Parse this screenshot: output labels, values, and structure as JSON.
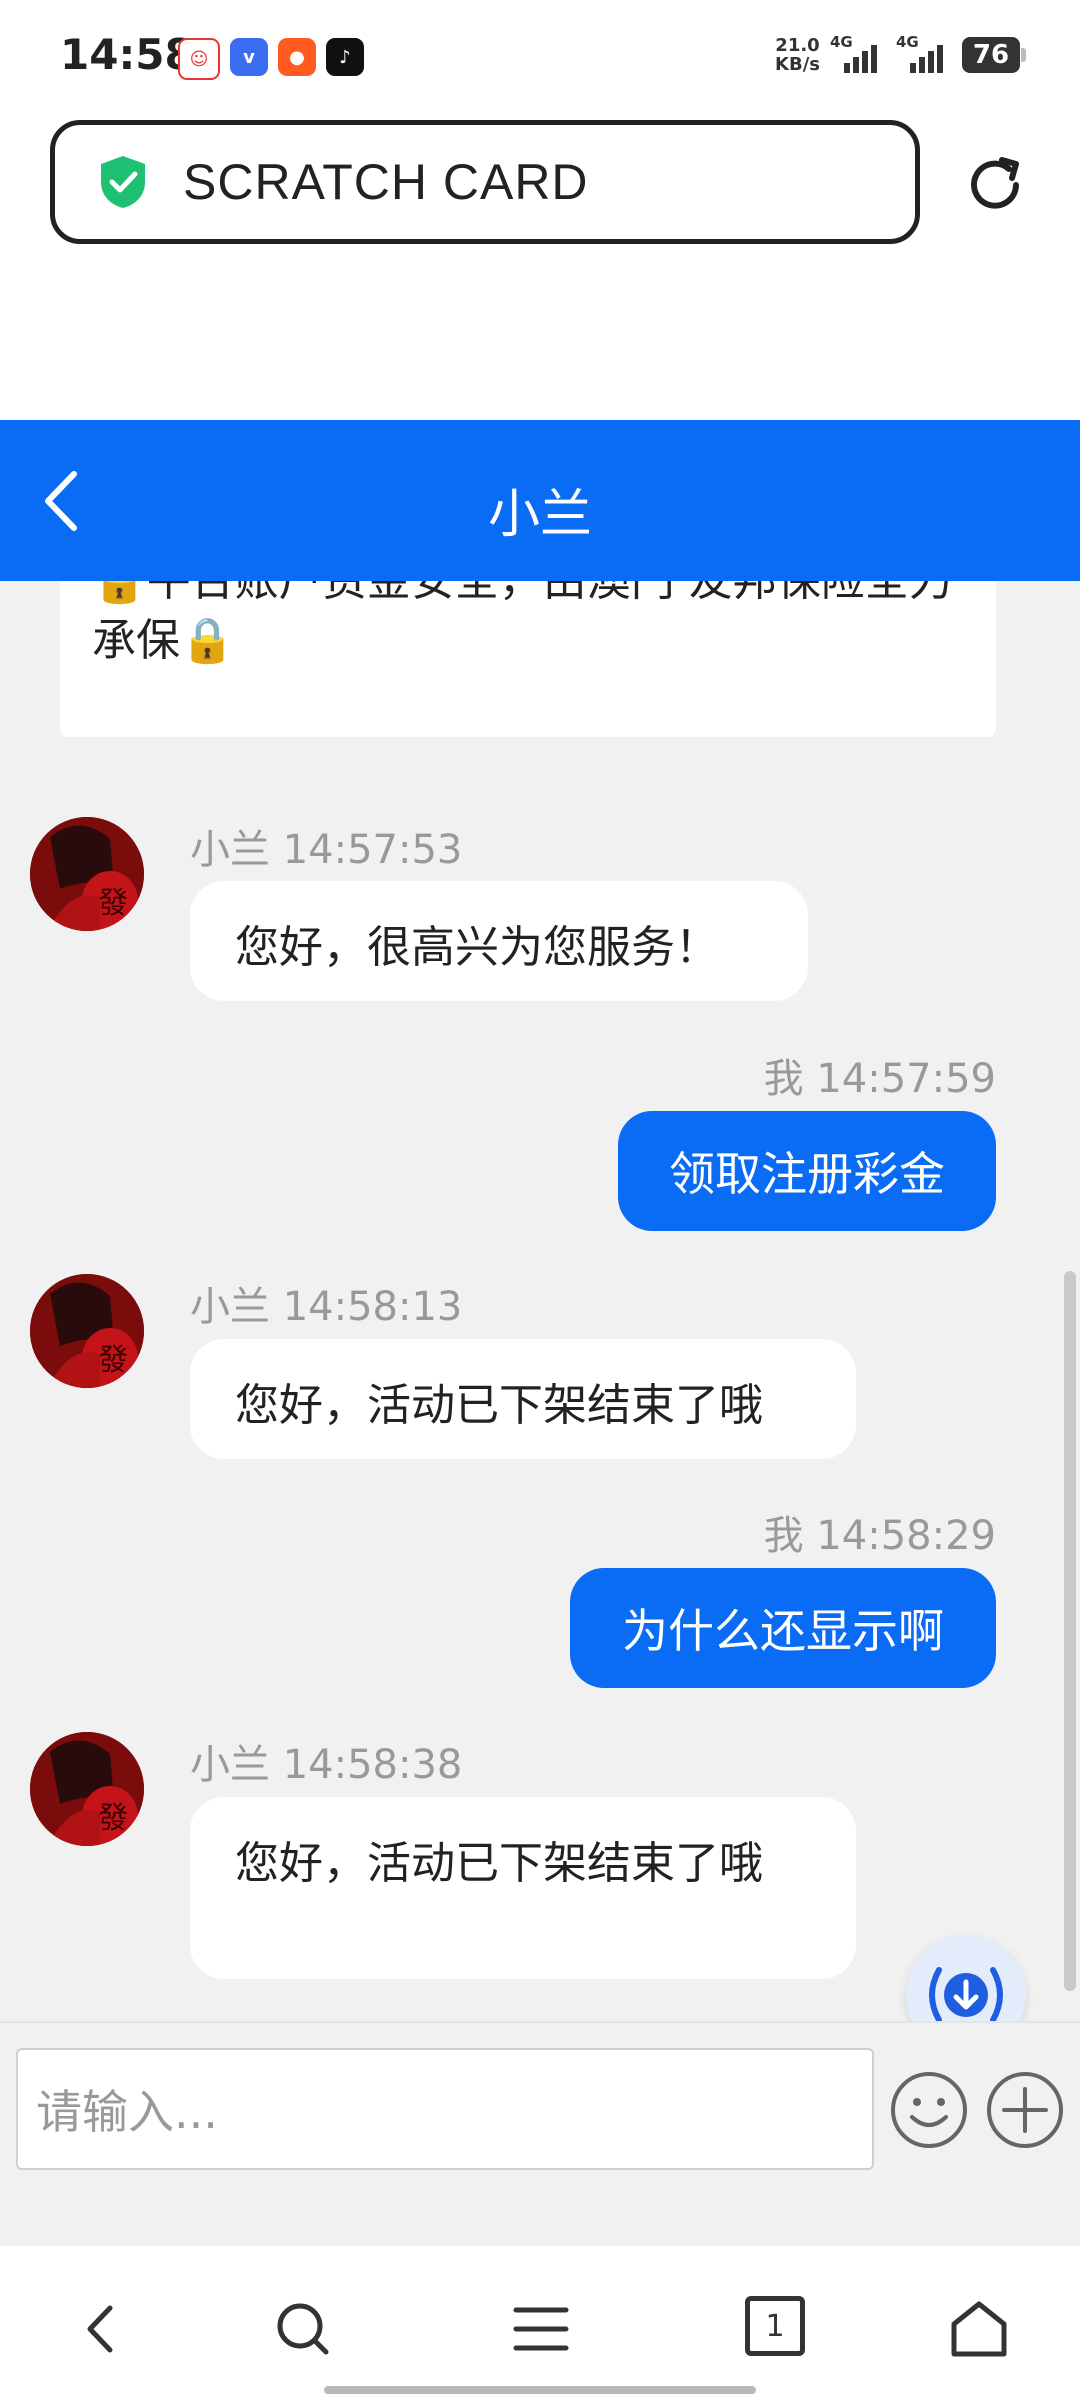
{
  "status_bar": {
    "time": "14:58",
    "net_speed_value": "21.0",
    "net_speed_unit": "KB/s",
    "signal_1_label": "4G",
    "signal_2_label": "4G",
    "battery": "76"
  },
  "browser": {
    "url_text": "SCRATCH CARD"
  },
  "chat": {
    "title": "小兰",
    "notice_text": "🔒平台账户资金安全，由澳门 友邦保险全力承保🔒",
    "messages": [
      {
        "from": "agent",
        "meta": "小兰 14:57:53",
        "text": "您好，很高兴为您服务！"
      },
      {
        "from": "me",
        "meta": "我 14:57:59",
        "text": "领取注册彩金"
      },
      {
        "from": "agent",
        "meta": "小兰 14:58:13",
        "text": "您好，活动已下架结束了哦"
      },
      {
        "from": "me",
        "meta": "我 14:58:29",
        "text": "为什么还显示啊"
      },
      {
        "from": "agent",
        "meta": "小兰 14:58:38",
        "text": "您好，活动已下架结束了哦"
      }
    ],
    "input_placeholder": "请输入..."
  },
  "bottom_nav": {
    "tab_count": "1"
  },
  "colors": {
    "accent": "#0a6cf5",
    "chat_background": "#f1f1f1",
    "shield": "#1fbf74"
  },
  "icons": [
    "shield-check-icon",
    "reload-icon",
    "back-chevron-icon",
    "download-icon",
    "emoji-icon",
    "plus-icon",
    "nav-back-icon",
    "search-icon",
    "menu-icon",
    "tabs-icon",
    "home-icon"
  ]
}
